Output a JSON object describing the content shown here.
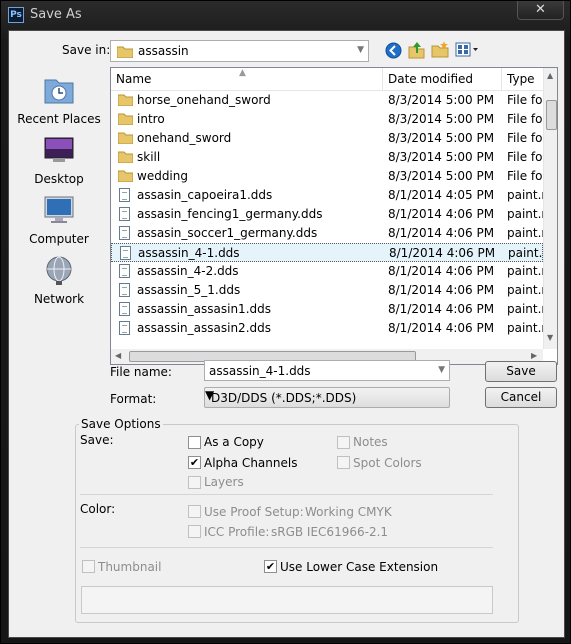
{
  "window": {
    "title": "Save As",
    "app_icon": "Ps",
    "close_label": "✕"
  },
  "save_in": {
    "label": "Save in:",
    "value": "assassin"
  },
  "sidebar": [
    {
      "label": "Recent Places",
      "icon": "recent-places-icon"
    },
    {
      "label": "Desktop",
      "icon": "desktop-icon"
    },
    {
      "label": "Computer",
      "icon": "computer-icon"
    },
    {
      "label": "Network",
      "icon": "network-icon"
    }
  ],
  "file_list": {
    "columns": [
      "Name",
      "Date modified",
      "Type"
    ],
    "rows": [
      {
        "name": "horse_onehand_sword",
        "date": "8/3/2014 5:00 PM",
        "type": "File fol",
        "kind": "folder"
      },
      {
        "name": "intro",
        "date": "8/3/2014 5:00 PM",
        "type": "File fol",
        "kind": "folder"
      },
      {
        "name": "onehand_sword",
        "date": "8/3/2014 5:00 PM",
        "type": "File fol",
        "kind": "folder"
      },
      {
        "name": "skill",
        "date": "8/3/2014 5:00 PM",
        "type": "File fol",
        "kind": "folder"
      },
      {
        "name": "wedding",
        "date": "8/3/2014 5:00 PM",
        "type": "File fol",
        "kind": "folder"
      },
      {
        "name": "assasin_capoeira1.dds",
        "date": "8/1/2014 4:05 PM",
        "type": "paint.n",
        "kind": "file"
      },
      {
        "name": "assasin_fencing1_germany.dds",
        "date": "8/1/2014 4:06 PM",
        "type": "paint.n",
        "kind": "file"
      },
      {
        "name": "assasin_soccer1_germany.dds",
        "date": "8/1/2014 4:06 PM",
        "type": "paint.n",
        "kind": "file"
      },
      {
        "name": "assassin_4-1.dds",
        "date": "8/1/2014 4:06 PM",
        "type": "paint.n",
        "kind": "file",
        "selected": true
      },
      {
        "name": "assassin_4-2.dds",
        "date": "8/1/2014 4:06 PM",
        "type": "paint.n",
        "kind": "file"
      },
      {
        "name": "assassin_5_1.dds",
        "date": "8/1/2014 4:06 PM",
        "type": "paint.n",
        "kind": "file"
      },
      {
        "name": "assassin_assasin1.dds",
        "date": "8/1/2014 4:06 PM",
        "type": "paint.n",
        "kind": "file"
      },
      {
        "name": "assassin_assasin2.dds",
        "date": "8/1/2014 4:06 PM",
        "type": "paint.n",
        "kind": "file"
      }
    ]
  },
  "file_name": {
    "label": "File name:",
    "value": "assassin_4-1.dds"
  },
  "format": {
    "label": "Format:",
    "value": "D3D/DDS (*.DDS;*.DDS)"
  },
  "buttons": {
    "save": "Save",
    "cancel": "Cancel"
  },
  "save_options": {
    "title": "Save Options",
    "save_label": "Save:",
    "as_a_copy": "As a Copy",
    "alpha_channels": "Alpha Channels",
    "layers": "Layers",
    "notes": "Notes",
    "spot_colors": "Spot Colors",
    "color_label": "Color:",
    "use_proof_setup": "Use Proof Setup:",
    "proof_value": "Working CMYK",
    "icc_profile": "ICC Profile:",
    "icc_value": "sRGB IEC61966-2.1",
    "thumbnail": "Thumbnail",
    "lower_case": "Use Lower Case Extension"
  },
  "colors": {
    "selection": "#e5f3fb",
    "folder": "#e7c66b",
    "window_frame": "#1a1a1a"
  }
}
